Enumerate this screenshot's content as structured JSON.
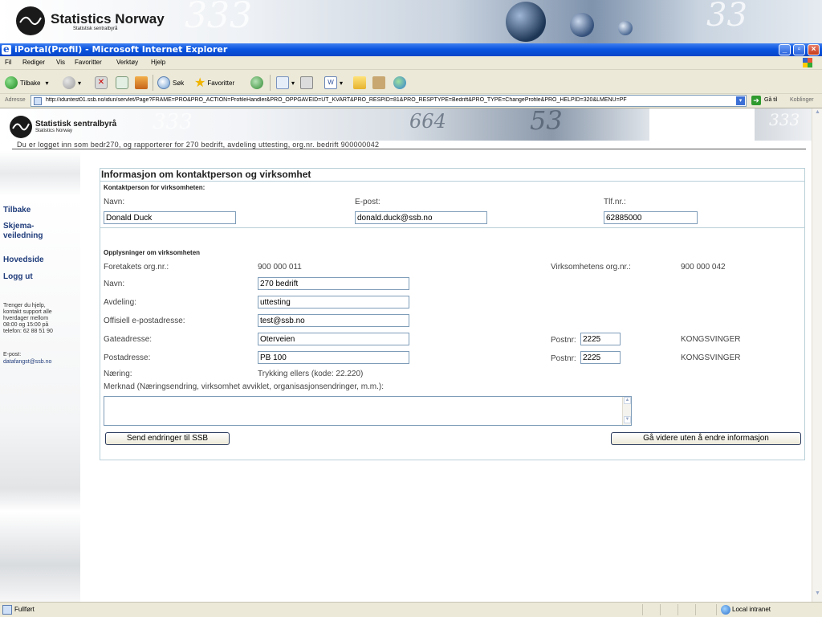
{
  "banner": {
    "title": "Statistics Norway",
    "subtitle": "Statistisk sentralbyrå"
  },
  "window": {
    "title": "iPortal(Profil) - Microsoft Internet Explorer"
  },
  "menu": [
    "Fil",
    "Rediger",
    "Vis",
    "Favoritter",
    "Verktøy",
    "Hjelp"
  ],
  "toolbar": {
    "back": "Tilbake",
    "search": "Søk",
    "favorites": "Favoritter"
  },
  "addressbar": {
    "label": "Adresse",
    "url": "http://iduntest01.ssb.no/idun/servlet/Page?FRAME=PRO&PRO_ACTION=ProfileHandler&PRO_OPPGAVEID=UT_KVART&PRO_RESPID=81&PRO_RESPTYPE=Bedrift&PRO_TYPE=ChangeProfile&PRO_HELPID=320&LMENU=PF",
    "go": "Gå til",
    "links": "Koblinger"
  },
  "page_header": {
    "title": "Statistisk sentralbyrå",
    "subtitle": "Statistics Norway"
  },
  "logged_in": "Du er logget inn som bedr270, og rapporterer for 270 bedrift, avdeling uttesting, org.nr. bedrift 900000042",
  "sidebar": {
    "links": [
      "Tilbake",
      "Skjema-\nveiledning",
      "Hovedside",
      "Logg ut"
    ],
    "help_text": "Trenger du hjelp,\nkontakt support alle\nhverdager mellom\n08:00 og 15:00 på\ntelefon: 62 88 51 90",
    "email_label": "E-post:",
    "email": "datafangst@ssb.no"
  },
  "form": {
    "title": "Informasjon om kontaktperson og virksomhet",
    "contact_section": "Kontaktperson for virksomheten:",
    "name_label": "Navn:",
    "name_value": "Donald Duck",
    "email_label": "E-post:",
    "email_value": "donald.duck@ssb.no",
    "phone_label": "Tlf.nr.:",
    "phone_value": "62885000",
    "company_section": "Opplysninger om virksomheten",
    "orgnr_label": "Foretakets org.nr.:",
    "orgnr_value": "900 000 011",
    "v_orgnr_label": "Virksomhetens org.nr.:",
    "v_orgnr_value": "900 000 042",
    "c_name_label": "Navn:",
    "c_name_value": "270 bedrift",
    "dept_label": "Avdeling:",
    "dept_value": "uttesting",
    "official_email_label": "Offisiell e-postadresse:",
    "official_email_value": "test@ssb.no",
    "street_label": "Gateadresse:",
    "street_value": "Oterveien",
    "postnr_label": "Postnr:",
    "street_postnr": "2225",
    "street_city": "KONGSVINGER",
    "postal_label": "Postadresse:",
    "postal_value": "PB 100",
    "postal_postnr": "2225",
    "postal_city": "KONGSVINGER",
    "industry_label": "Næring:",
    "industry_value": "Trykking ellers (kode: 22.220)",
    "remark_label": "Merknad (Næringsendring, virksomhet avviklet, organisasjonsendringer, m.m.):",
    "send_button": "Send endringer til SSB",
    "continue_button": "Gå videre uten å endre informasjon"
  },
  "statusbar": {
    "status": "Fullført",
    "zone": "Local intranet"
  }
}
